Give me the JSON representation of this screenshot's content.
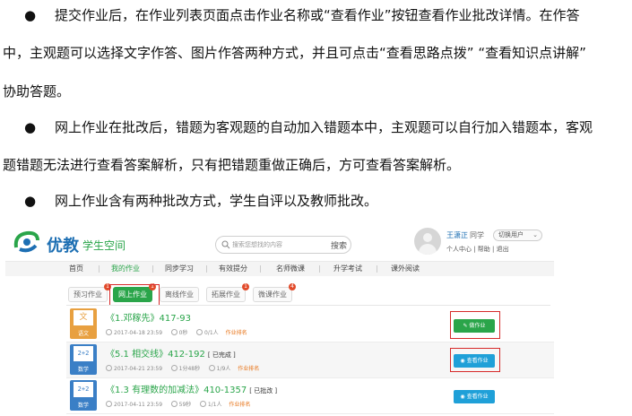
{
  "doc": {
    "bullet": "●",
    "p1_line1": "提交作业后，在作业列表页面点击作业名称或“查看作业”按钮查看作业批改详情。在作答",
    "p1_line2": "中，主观题可以选择文字作答、图片作答两种方式，并且可点击“查看思路点拨” “查看知识点讲解”",
    "p1_line3": "协助答题。",
    "p2_line1": "网上作业在批改后，错题为客观题的自动加入错题本中，主观题可以自行加入错题本，客观",
    "p2_line2": "题错题无法进行查看答案解析，只有把错题重做正确后，方可查看答案解析。",
    "p3_line1": "网上作业含有两种批改方式，学生自评以及教师批改。"
  },
  "header": {
    "brand": "优教",
    "brand_sub": "学生空间",
    "search_placeholder": "搜索您想找的内容",
    "search_button": "搜索",
    "user_name": "王潇正",
    "user_suffix": "同学",
    "switch_user": "切换用户",
    "user_links": "个人中心 | 帮助 | 退出"
  },
  "nav": {
    "items": [
      "首页",
      "我的作业",
      "同步学习",
      "有效提分",
      "名师微课",
      "升学考试",
      "课外阅读"
    ]
  },
  "tabs": {
    "items": [
      {
        "label": "预习作业",
        "badge": ""
      },
      {
        "label": "网上作业",
        "badge": "1"
      },
      {
        "label": "离线作业",
        "badge": "1"
      },
      {
        "label": "拓展作业",
        "badge": "1"
      },
      {
        "label": "微课作业",
        "badge": "4"
      }
    ]
  },
  "rows": [
    {
      "subject": "语文",
      "glyph": "文",
      "title": "《1.邓稼先》417-93",
      "status": "",
      "date": "2017-04-18 23:59",
      "time": "0秒",
      "progress": "0/1人",
      "rank": "作业排名",
      "action": "做作业"
    },
    {
      "subject": "数学",
      "glyph": "2+2",
      "title": "《5.1 相交线》412-192",
      "status": "[ 已完成 ]",
      "date": "2017-04-21 23:59",
      "time": "1分48秒",
      "progress": "1/9人",
      "rank": "作业排名",
      "action": "查看作业"
    },
    {
      "subject": "数学",
      "glyph": "2+2",
      "title": "《1.3 有理数的加减法》410-1357",
      "status": "[ 已批改 ]",
      "date": "2017-04-11 23:59",
      "time": "59秒",
      "progress": "1/1人",
      "rank": "作业排名",
      "action": "查看作业"
    }
  ],
  "colors": {
    "accent_green": "#2aa54a",
    "accent_blue": "#1fa0d8",
    "highlight_red": "#d62a2a",
    "rank_orange": "#e8761c"
  }
}
